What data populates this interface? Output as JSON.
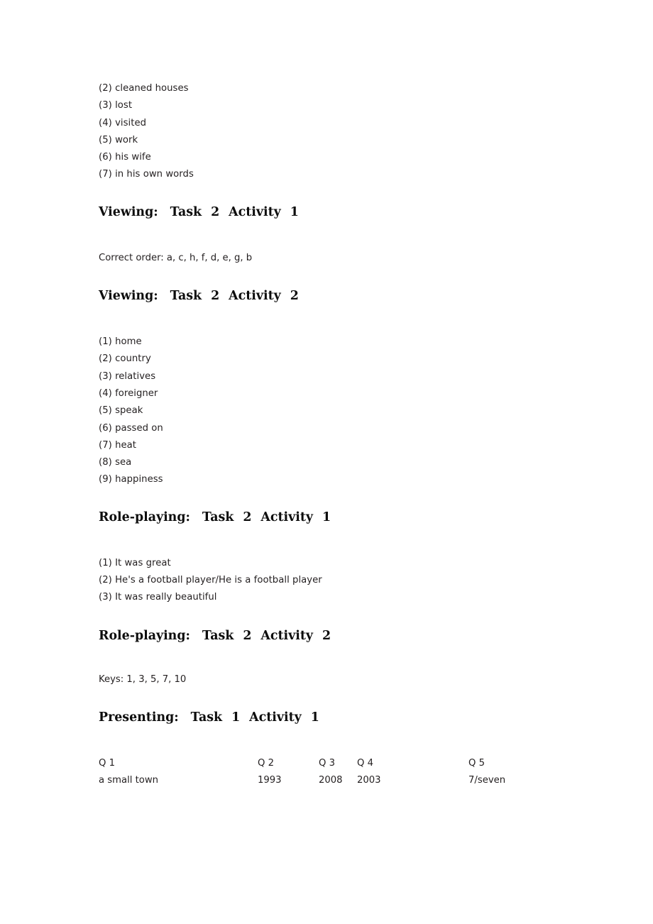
{
  "document": {
    "background_color": "#ffffff",
    "text_color": "#231f20",
    "heading_color": "#0d0d0d"
  },
  "sections": [
    {
      "id": "listening-answers-continued",
      "type": "answer_list",
      "items": [
        "(2) cleaned houses",
        "(3) lost",
        "(4) visited",
        "(5) work",
        "(6) his wife",
        "(7) in his own words"
      ]
    },
    {
      "id": "viewing-task2-activity1",
      "type": "heading_with_text",
      "heading": {
        "label": "Viewing:",
        "task_word": "Task",
        "task_number": "2",
        "activity_word": "Activity",
        "activity_number": "1"
      },
      "body": "Correct order: a, c, h, f, d, e, g, b"
    },
    {
      "id": "viewing-task2-activity2",
      "type": "heading_with_list",
      "heading": {
        "label": "Viewing:",
        "task_word": "Task",
        "task_number": "2",
        "activity_word": "Activity",
        "activity_number": "2"
      },
      "items": [
        "(1) home",
        "(2) country",
        "(3) relatives",
        "(4) foreigner",
        "(5) speak",
        "(6) passed on",
        "(7) heat",
        "(8) sea",
        "(9) happiness"
      ]
    },
    {
      "id": "roleplaying-task2-activity1",
      "type": "heading_with_list",
      "heading": {
        "label": "Role-playing:",
        "task_word": "Task",
        "task_number": "2",
        "activity_word": "Activity",
        "activity_number": "1"
      },
      "items": [
        "(1) It was great",
        "(2) He's a football player/He is a football player",
        "(3) It was really beautiful"
      ]
    },
    {
      "id": "roleplaying-task2-activity2",
      "type": "heading_with_text",
      "heading": {
        "label": "Role-playing:",
        "task_word": "Task",
        "task_number": "2",
        "activity_word": "Activity",
        "activity_number": "2"
      },
      "body": "Keys: 1, 3, 5, 7, 10"
    },
    {
      "id": "presenting-task1-activity1",
      "type": "heading_with_table",
      "heading": {
        "label": "Presenting:",
        "task_word": "Task",
        "task_number": "1",
        "activity_word": "Activity",
        "activity_number": "1"
      },
      "table": {
        "headers": [
          "Q 1",
          "Q 2",
          "Q 3",
          "Q 4",
          "Q 5"
        ],
        "row": [
          "a small town",
          "1993",
          "2008",
          "2003",
          "7/seven"
        ]
      }
    }
  ]
}
